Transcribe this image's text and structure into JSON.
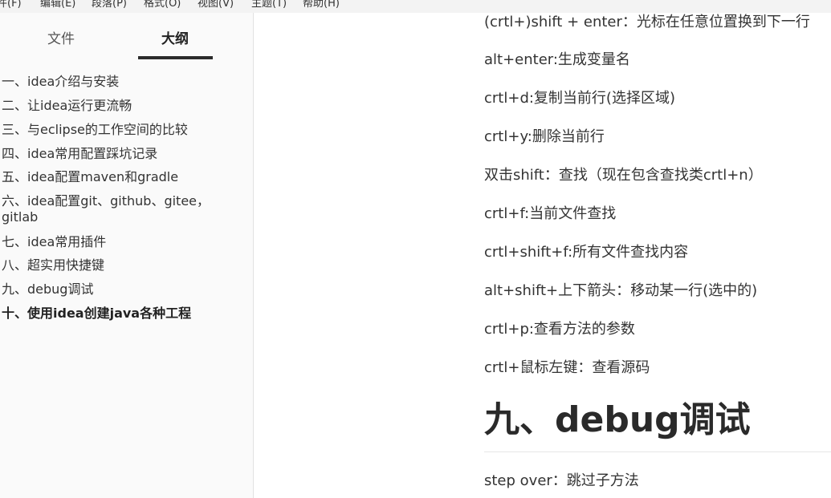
{
  "menubar": {
    "items": [
      "件(F)",
      "编辑(E)",
      "段落(P)",
      "格式(O)",
      "视图(V)",
      "主题(T)",
      "帮助(H)"
    ]
  },
  "sidebar": {
    "tabs": [
      {
        "label": "文件",
        "active": false
      },
      {
        "label": "大纲",
        "active": true
      }
    ],
    "outline": [
      "一、idea介绍与安装",
      "二、让idea运行更流畅",
      "三、与eclipse的工作空间的比较",
      "四、idea常用配置踩坑记录",
      "五、idea配置maven和gradle",
      "六、idea配置git、github、gitee，gitlab",
      "七、idea常用插件",
      "八、超实用快捷键",
      "九、debug调试",
      "十、使用idea创建java各种工程"
    ],
    "active_index": 9
  },
  "document": {
    "paragraphs": [
      "(crtl+)shift + enter：光标在任意位置换到下一行",
      "alt+enter:生成变量名",
      "crtl+d:复制当前行(选择区域)",
      "crtl+y:删除当前行",
      "双击shift：查找（现在包含查找类crtl+n）",
      "crtl+f:当前文件查找",
      "crtl+shift+f:所有文件查找内容",
      "alt+shift+上下箭头：移动某一行(选中的)",
      "crtl+p:查看方法的参数",
      "crtl+鼠标左键：查看源码"
    ],
    "heading": "九、debug调试",
    "after_heading": "step over：跳过子方法"
  }
}
